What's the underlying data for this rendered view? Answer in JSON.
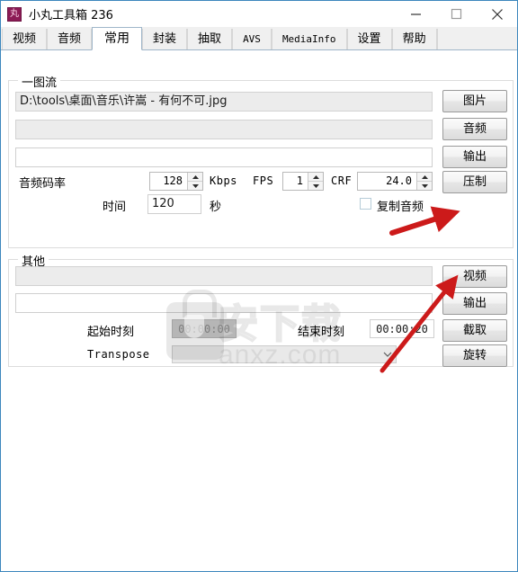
{
  "window": {
    "title": "小丸工具箱 236",
    "icon_glyph": "丸",
    "icon_color": "#8c1a55",
    "minimize_label": "minimize",
    "maximize_label": "maximize",
    "close_label": "close"
  },
  "tabs": [
    {
      "label": "视频",
      "active": false,
      "mono": false
    },
    {
      "label": "音频",
      "active": false,
      "mono": false
    },
    {
      "label": "常用",
      "active": true,
      "mono": false
    },
    {
      "label": "封装",
      "active": false,
      "mono": false
    },
    {
      "label": "抽取",
      "active": false,
      "mono": false
    },
    {
      "label": "AVS",
      "active": false,
      "mono": true
    },
    {
      "label": "MediaInfo",
      "active": false,
      "mono": true
    },
    {
      "label": "设置",
      "active": false,
      "mono": false
    },
    {
      "label": "帮助",
      "active": false,
      "mono": false
    }
  ],
  "group_image_stream": {
    "title": "一图流",
    "image_path": {
      "value": "D:\\tools\\桌面\\音乐\\许嵩 - 有何不可.jpg",
      "placeholder": ""
    },
    "audio_path": {
      "value": "",
      "placeholder": ""
    },
    "output_path": {
      "value": "",
      "placeholder": ""
    },
    "buttons": {
      "image": "图片",
      "audio": "音频",
      "output": "输出",
      "encode": "压制"
    },
    "audio_bitrate_label": "音频码率",
    "audio_bitrate_value": "128",
    "audio_bitrate_unit": "Kbps",
    "fps_label": "FPS",
    "fps_value": "1",
    "crf_label": "CRF",
    "crf_value": "24.0",
    "time_label": "时间",
    "time_value": "120",
    "time_unit": "秒",
    "copy_audio_label": "复制音频",
    "copy_audio_checked": false
  },
  "group_other": {
    "title": "其他",
    "video_path": {
      "value": "",
      "placeholder": ""
    },
    "output_path": {
      "value": "",
      "placeholder": ""
    },
    "buttons": {
      "video": "视频",
      "output": "输出",
      "clip": "截取",
      "rotate": "旋转"
    },
    "start_time_label": "起始时刻",
    "start_time_value": "00:00:00",
    "end_time_label": "结束时刻",
    "end_time_value": "00:00:20",
    "transpose_label": "Transpose",
    "transpose_value": ""
  },
  "watermark": {
    "text": "安下载",
    "url": "anxz.com"
  },
  "annotations": {
    "arrow_color": "#cc1a1a",
    "arrow_video_target": "视频",
    "arrow_clip_target": "截取"
  }
}
